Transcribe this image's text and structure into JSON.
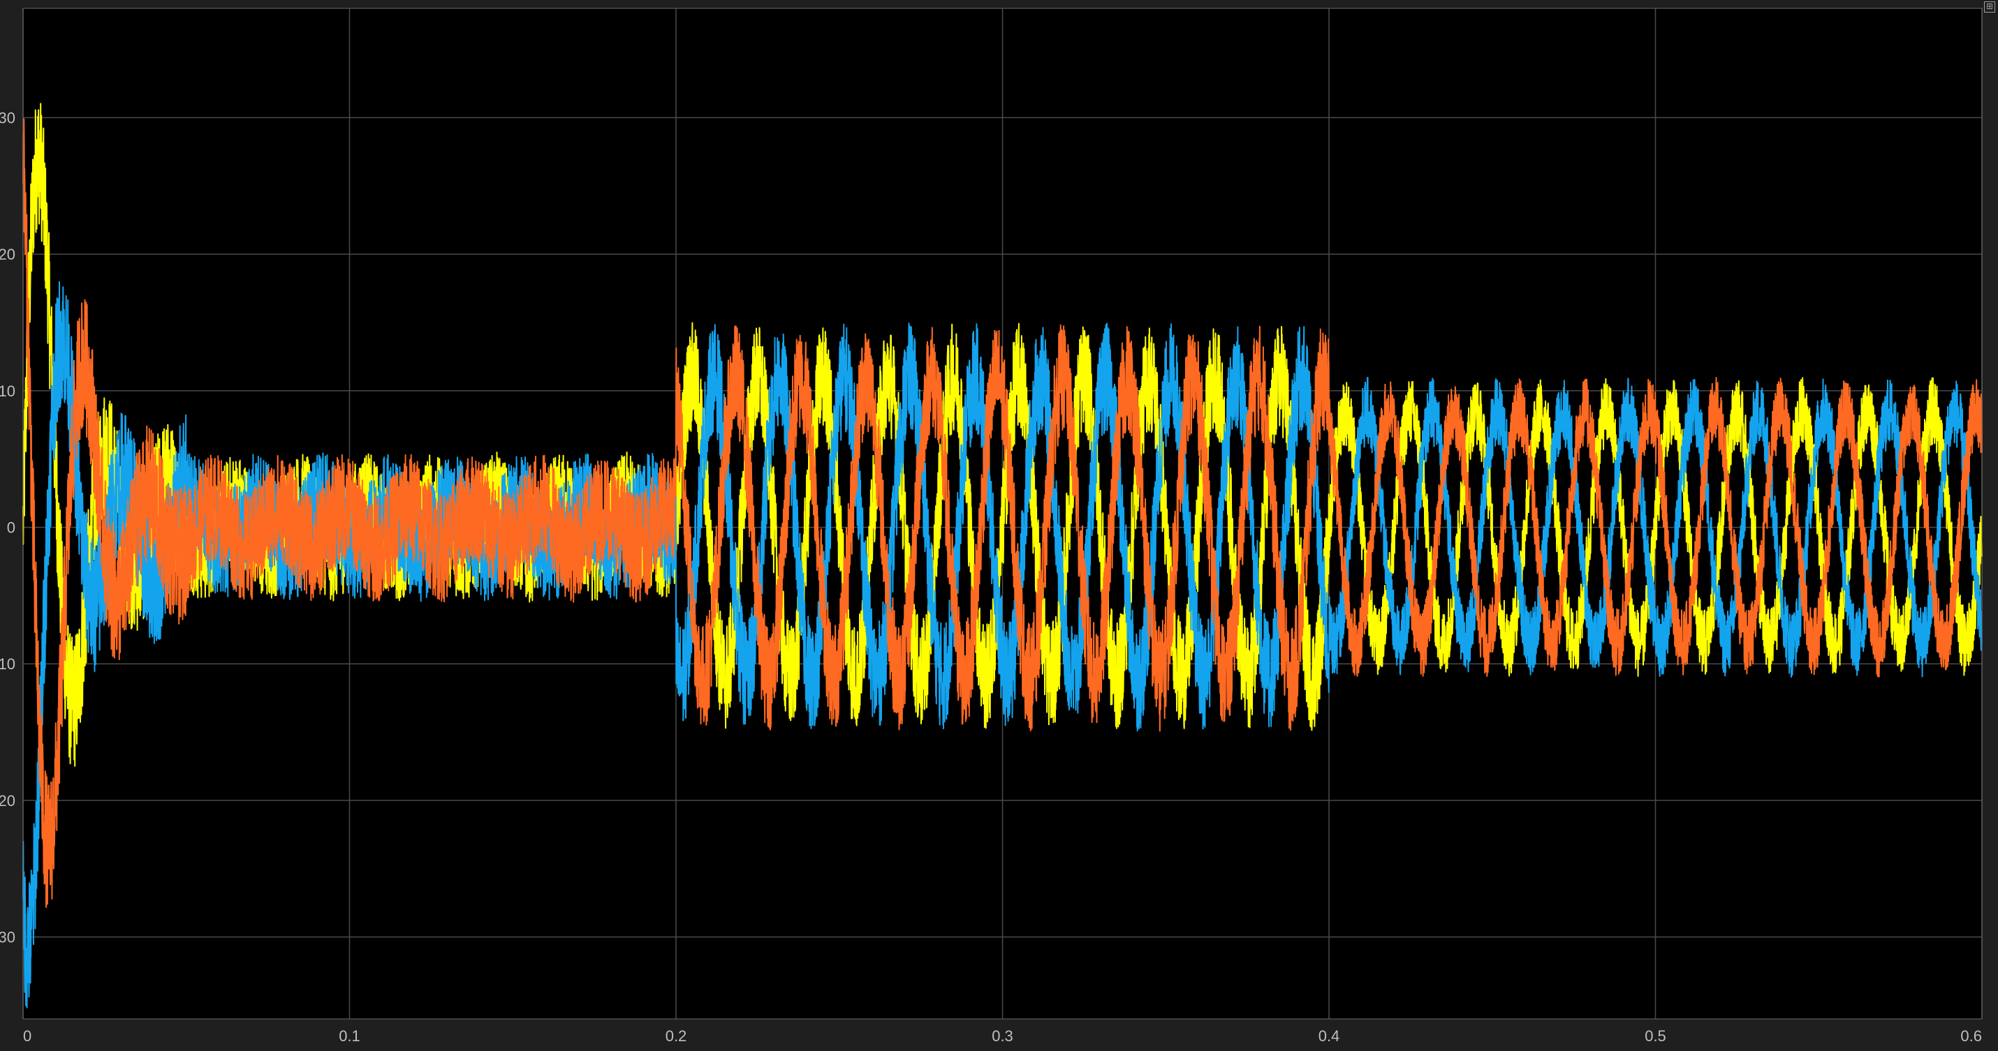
{
  "window": {
    "restore_icon": "restore-axes-icon",
    "restore_glyph": "⊞"
  },
  "colors": {
    "background": "#000000",
    "frame": "#1f1f1f",
    "grid": "#4a4a4a",
    "tick_text": "#bfbfbf",
    "phase_a": "#ffff00",
    "phase_b": "#14a4ee",
    "phase_c": "#ff6a22"
  },
  "chart_data": {
    "type": "line",
    "title": "",
    "xlabel": "",
    "ylabel": "",
    "xlim": [
      0,
      0.6
    ],
    "ylim": [
      -36,
      38
    ],
    "grid": true,
    "legend": "none",
    "x_ticks": [
      0,
      0.1,
      0.2,
      0.3,
      0.4,
      0.5,
      0.6
    ],
    "x_tick_labels": [
      "0",
      "0.1",
      "0.2",
      "0.3",
      "0.4",
      "0.5",
      "0.6"
    ],
    "y_ticks": [
      -30,
      -20,
      -10,
      0,
      10,
      20,
      30
    ],
    "y_tick_labels": [
      "30",
      "20",
      "10",
      "0",
      "10",
      "20",
      "30"
    ],
    "signal_model": {
      "frequency_hz": 50,
      "segments": [
        {
          "t_start": 0.0,
          "t_end": 0.05,
          "description": "startup transient, peaks near ±30",
          "amplitude_start": 28,
          "amplitude_end": 6
        },
        {
          "t_start": 0.05,
          "t_end": 0.2,
          "description": "low amplitude",
          "amplitude": 1.5,
          "ripple": 4
        },
        {
          "t_start": 0.2,
          "t_end": 0.4,
          "description": "loaded",
          "amplitude": 11,
          "ripple": 4
        },
        {
          "t_start": 0.4,
          "t_end": 0.6,
          "description": "reduced load",
          "amplitude": 8.5,
          "ripple": 2.5
        }
      ]
    },
    "series": [
      {
        "color": "#ffff00",
        "phase_deg": 0
      },
      {
        "color": "#14a4ee",
        "phase_deg": -120
      },
      {
        "color": "#ff6a22",
        "phase_deg": 120
      }
    ]
  }
}
